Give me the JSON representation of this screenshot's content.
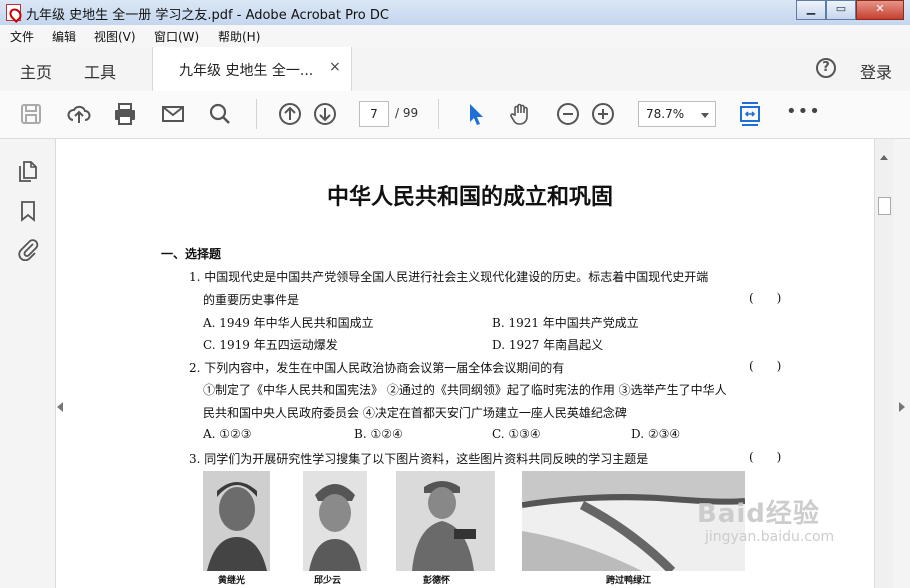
{
  "window": {
    "title": "九年级 史地生 全一册 学习之友.pdf - Adobe Acrobat Pro DC"
  },
  "menu": [
    "文件",
    "编辑",
    "视图(V)",
    "窗口(W)",
    "帮助(H)"
  ],
  "tabs": {
    "home": "主页",
    "tools": "工具",
    "document": "九年级 史地生 全一...",
    "close": "×",
    "login": "登录"
  },
  "toolbar": {
    "page_current": "7",
    "page_total": "/ 99",
    "zoom": "78.7%",
    "more": "•••"
  },
  "document": {
    "title": "中华人民共和国的成立和巩固",
    "section": "一、选择题",
    "lines": [
      "1. 中国现代史是中国共产党领导全国人民进行社会主义现代化建设的历史。标志着中国现代史开端",
      "的重要历史事件是",
      "A. 1949 年中华人民共和国成立",
      "B. 1921 年中国共产党成立",
      "C. 1919 年五四运动爆发",
      "D. 1927 年南昌起义",
      "2. 下列内容中，发生在中国人民政治协商会议第一届全体会议期间的有",
      "①制定了《中华人民共和国宪法》 ②通过的《共同纲领》起了临时宪法的作用 ③选举产生了中华人",
      "民共和国中央人民政府委员会 ④决定在首都天安门广场建立一座人民英雄纪念碑",
      "A. ①②③",
      "B. ①②④",
      "C. ①③④",
      "D. ②③④",
      "3. 同学们为开展研究性学习搜集了以下图片资料，这些图片资料共同反映的学习主题是"
    ],
    "answer_bracket": "(      )",
    "captions": [
      "黄继光",
      "邱少云",
      "彭德怀",
      "跨过鸭绿江"
    ]
  },
  "watermark": {
    "brand": "Baid经验",
    "url": "jingyan.baidu.com"
  }
}
